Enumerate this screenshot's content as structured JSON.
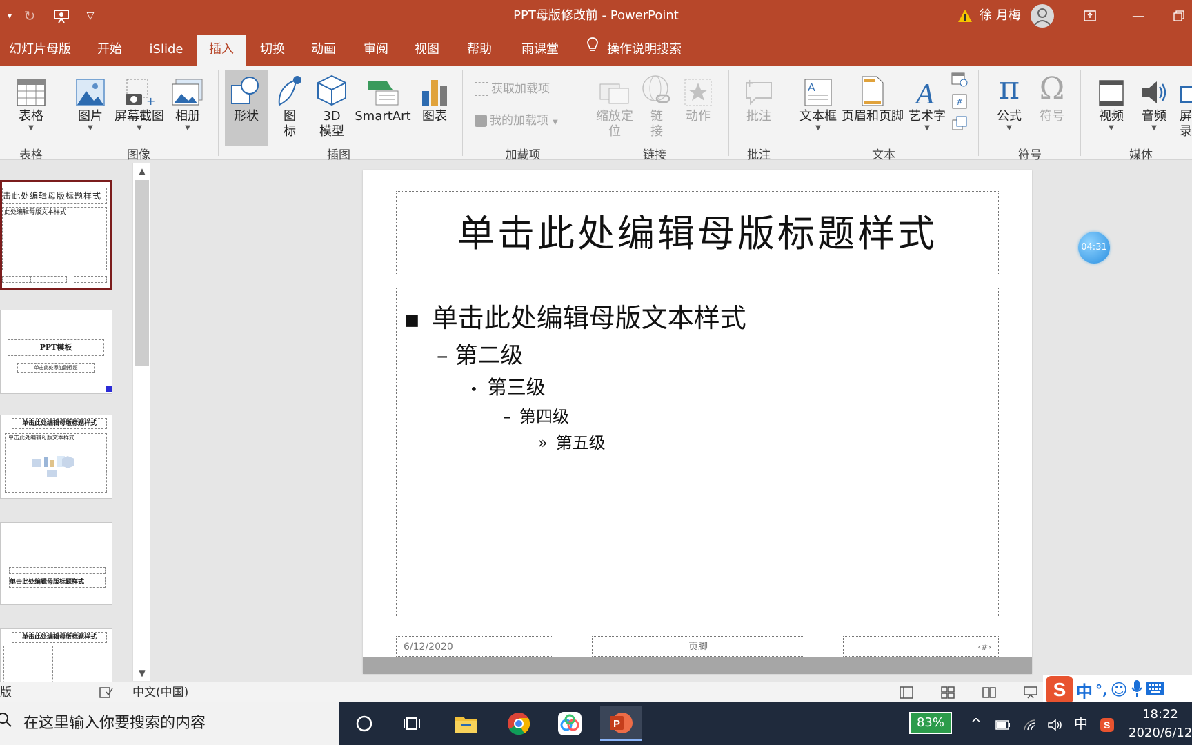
{
  "titlebar": {
    "title": "PPT母版修改前  -  PowerPoint",
    "user": "徐 月梅"
  },
  "tabs": [
    {
      "label": "幻灯片母版"
    },
    {
      "label": "开始"
    },
    {
      "label": "iSlide"
    },
    {
      "label": "插入"
    },
    {
      "label": "切换"
    },
    {
      "label": "动画"
    },
    {
      "label": "审阅"
    },
    {
      "label": "视图"
    },
    {
      "label": "帮助"
    },
    {
      "label": "雨课堂"
    }
  ],
  "tellme": "操作说明搜索",
  "ribbon": {
    "table": "表格",
    "picture": "图片",
    "screenshot": "屏幕截图",
    "album": "相册",
    "shapes": "形状",
    "icons": "图\n标",
    "model3d": "3D\n模型",
    "smartart": "SmartArt",
    "chart": "图表",
    "get_addins": "获取加载项",
    "my_addins": "我的加载项",
    "zoom": "缩放定\n位",
    "link": "链\n接",
    "action": "动作",
    "comment": "批注",
    "textbox": "文本框",
    "header_footer": "页眉和页脚",
    "wordart": "艺术字",
    "equation": "公式",
    "symbol": "符号",
    "video": "视频",
    "audio": "音频",
    "record": "屏\n录",
    "groups": {
      "tables": "表格",
      "images": "图像",
      "illustrations": "插图",
      "addins": "加载项",
      "links": "链接",
      "comments": "批注",
      "text": "文本",
      "symbols": "符号",
      "media": "媒体"
    }
  },
  "thumbs": {
    "t1_title": "击此处编辑母版标题样式",
    "t1_body": "此处编辑母版文本样式",
    "t2_title": "PPT模板",
    "t2_sub": "单击此处添加副标题",
    "t3_title": "单击此处编辑母版标题样式",
    "t3_body": "单击此处编辑母版文本样式",
    "t4_title": "单击此处编辑母版标题样式",
    "t5_title": "单击此处编辑母版标题样式"
  },
  "slide": {
    "title": "单击此处编辑母版标题样式",
    "levels": [
      {
        "bullet": "■",
        "text": "单击此处编辑母版文本样式"
      },
      {
        "bullet": "–",
        "text": "第二级"
      },
      {
        "bullet": "•",
        "text": "第三级"
      },
      {
        "bullet": "–",
        "text": "第四级"
      },
      {
        "bullet": "»",
        "text": "第五级"
      }
    ],
    "date": "6/12/2020",
    "footer": "页脚",
    "number": "‹#›"
  },
  "timer": "04:31",
  "status": {
    "view": "版",
    "language": "中文(中国)"
  },
  "taskbar": {
    "search_placeholder": "在这里输入你要搜索的内容",
    "battery": "83%",
    "ime": "中",
    "time": "18:22",
    "date": "2020/6/12"
  },
  "ime_bar": {
    "mode": "中",
    "punct": "°,"
  },
  "colors": {
    "accent": "#b7472a",
    "ribbon_bg": "#f3f3f3",
    "taskbar": "#1f2a3c"
  }
}
